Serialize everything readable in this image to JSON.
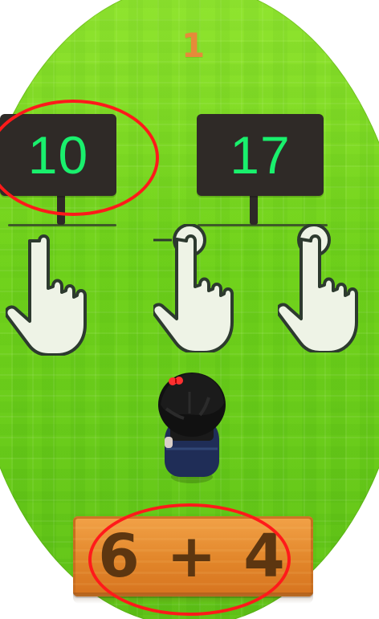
{
  "game": {
    "score": "1",
    "left_sign_value": "10",
    "right_sign_value": "17",
    "equation": "6 + 4"
  },
  "colors": {
    "grass": "#6ccc1a",
    "sign_board": "#2f2a27",
    "sign_text": "#19f06d",
    "score_text": "#e68a3a",
    "highlight": "#ff1a1a",
    "plank": "#e2862a",
    "plank_text": "#5d3610"
  },
  "icons": {
    "left_hand": "tap-hand-icon",
    "center_hand": "swipe-left-hand-icon",
    "right_hand": "tap-hand-icon",
    "player": "player-character-icon"
  }
}
